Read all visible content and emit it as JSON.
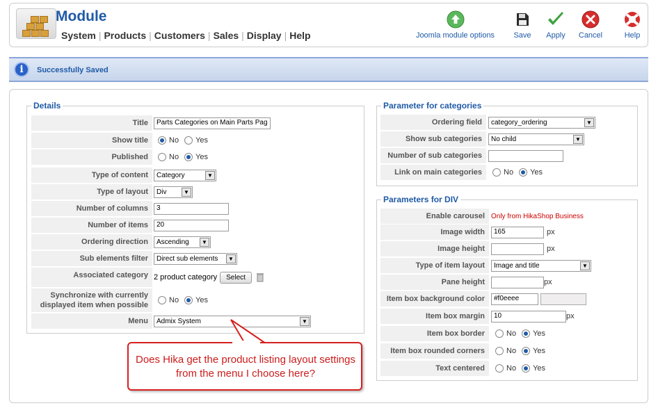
{
  "header": {
    "title": "Module",
    "menu": [
      "System",
      "Products",
      "Customers",
      "Sales",
      "Display",
      "Help"
    ],
    "toolbar": {
      "joomla_options": "Joomla module options",
      "save": "Save",
      "apply": "Apply",
      "cancel": "Cancel",
      "help": "Help"
    }
  },
  "message": "Successfully Saved",
  "details": {
    "legend": "Details",
    "title_label": "Title",
    "title_value": "Parts Categories on Main Parts Pag",
    "show_title_label": "Show title",
    "published_label": "Published",
    "type_content_label": "Type of content",
    "type_content_value": "Category",
    "type_layout_label": "Type of layout",
    "type_layout_value": "Div",
    "num_columns_label": "Number of columns",
    "num_columns_value": "3",
    "num_items_label": "Number of items",
    "num_items_value": "20",
    "ordering_dir_label": "Ordering direction",
    "ordering_dir_value": "Ascending",
    "sub_filter_label": "Sub elements filter",
    "sub_filter_value": "Direct sub elements",
    "assoc_cat_label": "Associated category",
    "assoc_cat_value": "2 product category",
    "select_button": "Select",
    "sync_label_1": "Synchronize with currently",
    "sync_label_2": "displayed item when possible",
    "menu_label": "Menu",
    "menu_value": "Admix System",
    "no": "No",
    "yes": "Yes"
  },
  "categories": {
    "legend": "Parameter for categories",
    "ordering_field_label": "Ordering field",
    "ordering_field_value": "category_ordering",
    "show_sub_label": "Show sub categories",
    "show_sub_value": "No child",
    "num_sub_label": "Number of sub categories",
    "num_sub_value": "",
    "link_main_label": "Link on main categories"
  },
  "div": {
    "legend": "Parameters for DIV",
    "carousel_label": "Enable carousel",
    "carousel_value": "Only from HikaShop Business",
    "img_width_label": "Image width",
    "img_width_value": "165",
    "img_height_label": "Image height",
    "img_height_value": "",
    "item_layout_label": "Type of item layout",
    "item_layout_value": "Image and title",
    "pane_height_label": "Pane height",
    "pane_height_value": "",
    "bg_color_label": "Item box background color",
    "bg_color_value": "#f0eeee",
    "margin_label": "Item box margin",
    "margin_value": "10",
    "border_label": "Item box border",
    "rounded_label": "Item box rounded corners",
    "centered_label": "Text centered",
    "px": "px"
  },
  "callout": "Does Hika get the product listing layout settings from the menu I choose here?",
  "colors": {
    "accent": "#1f5aa6",
    "message_bg": "#c7d5ec",
    "callout_border": "#d61f1f",
    "swatch": "#f0eeee"
  }
}
